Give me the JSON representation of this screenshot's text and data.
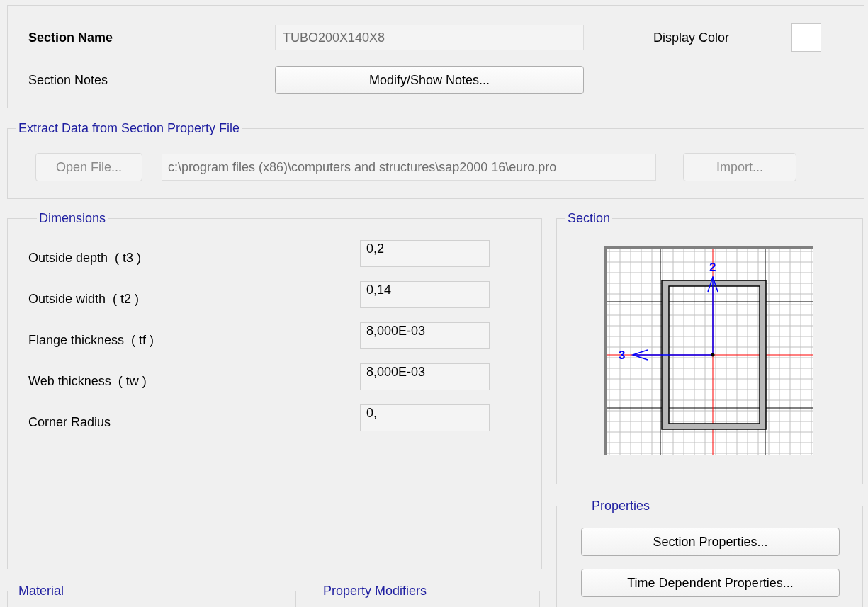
{
  "section_name": {
    "label": "Section Name",
    "value": "TUBO200X140X8",
    "disabled": true
  },
  "display_color": {
    "label": "Display Color",
    "color": "#ffffff"
  },
  "section_notes": {
    "label": "Section Notes",
    "button": "Modify/Show Notes..."
  },
  "extract": {
    "title": "Extract Data from Section Property File",
    "open_button": {
      "label": "Open File...",
      "disabled": true
    },
    "file_path": {
      "value": "c:\\program files (x86)\\computers and structures\\sap2000 16\\euro.pro",
      "disabled": true
    },
    "import_button": {
      "label": "Import...",
      "disabled": true
    }
  },
  "dimensions": {
    "title": "Dimensions",
    "rows": [
      {
        "label": "Outside depth  ( t3 )",
        "value": "0,2"
      },
      {
        "label": "Outside width  ( t2 )",
        "value": "0,14"
      },
      {
        "label": "Flange thickness  ( tf )",
        "value": "8,000E-03"
      },
      {
        "label": "Web thickness  ( tw )",
        "value": "8,000E-03"
      },
      {
        "label": "Corner Radius",
        "value": "0,"
      }
    ]
  },
  "section": {
    "title": "Section",
    "axis_labels": [
      "2",
      "3"
    ]
  },
  "properties": {
    "title": "Properties",
    "buttons": [
      "Section Properties...",
      "Time Dependent Properties..."
    ]
  },
  "material": {
    "title": "Material"
  },
  "property_modifiers": {
    "title": "Property Modifiers"
  }
}
